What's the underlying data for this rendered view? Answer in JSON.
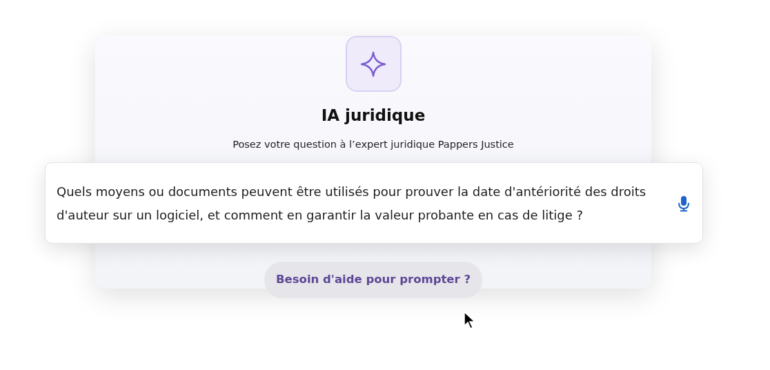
{
  "title": "IA juridique",
  "subtitle": "Posez votre question à l’expert juridique Pappers Justice",
  "question": {
    "value": "Quels moyens ou documents peuvent être utilisés pour prouver la date d'antériorité des droits d'auteur sur un logiciel, et comment en garantir la valeur probante en cas de litige ?"
  },
  "help_button": {
    "label": "Besoin d'aide pour prompter ?"
  }
}
